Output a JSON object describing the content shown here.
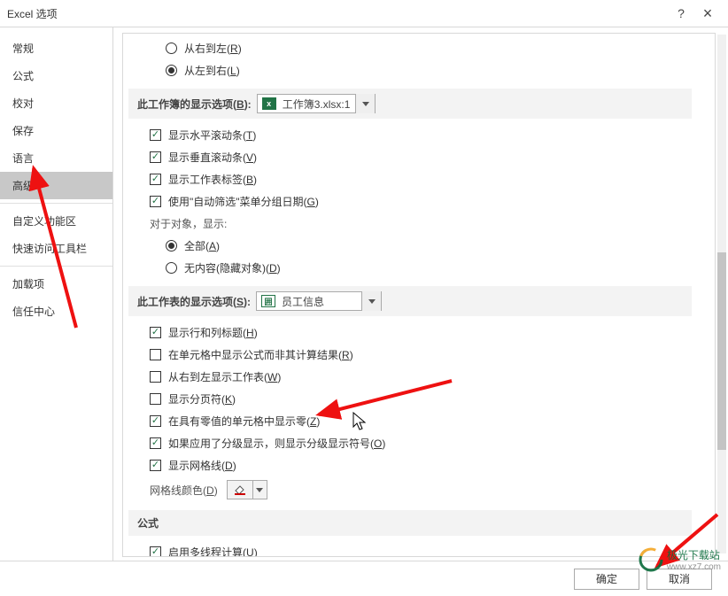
{
  "window": {
    "title": "Excel 选项",
    "help_btn": "?",
    "close_btn": "×"
  },
  "sidebar": {
    "items": [
      {
        "label": "常规"
      },
      {
        "label": "公式"
      },
      {
        "label": "校对"
      },
      {
        "label": "保存"
      },
      {
        "label": "语言"
      },
      {
        "label": "高级",
        "selected": true
      },
      {
        "label": "自定义功能区"
      },
      {
        "label": "快速访问工具栏"
      },
      {
        "label": "加载项"
      },
      {
        "label": "信任中心"
      }
    ]
  },
  "top_radio": {
    "opt1": "从右到左",
    "opt1_key": "R",
    "opt2": "从左到右",
    "opt2_key": "L"
  },
  "section_workbook": {
    "label": "此工作簿的显示选项",
    "key": "B",
    "dropdown": "工作簿3.xlsx:1",
    "items": {
      "horiz_scroll": {
        "label": "显示水平滚动条",
        "key": "T",
        "checked": true
      },
      "vert_scroll": {
        "label": "显示垂直滚动条",
        "key": "V",
        "checked": true
      },
      "sheet_tabs": {
        "label": "显示工作表标签",
        "key": "B",
        "checked": true
      },
      "autofilter": {
        "label": "使用\"自动筛选\"菜单分组日期",
        "key": "G",
        "checked": true
      }
    },
    "objects_label": "对于对象，显示:",
    "obj_all": {
      "label": "全部",
      "key": "A"
    },
    "obj_none": {
      "label": "无内容(隐藏对象)",
      "key": "D"
    }
  },
  "section_worksheet": {
    "label": "此工作表的显示选项",
    "key": "S",
    "dropdown": "员工信息",
    "items": {
      "row_col_headers": {
        "label": "显示行和列标题",
        "key": "H",
        "checked": true
      },
      "show_formulas": {
        "label": "在单元格中显示公式而非其计算结果",
        "key": "R",
        "checked": false
      },
      "rtl_sheet": {
        "label": "从右到左显示工作表",
        "key": "W",
        "checked": false
      },
      "page_breaks": {
        "label": "显示分页符",
        "key": "K",
        "checked": false
      },
      "show_zero": {
        "label": "在具有零值的单元格中显示零",
        "key": "Z",
        "checked": true
      },
      "outline_symbols": {
        "label": "如果应用了分级显示，则显示分级显示符号",
        "key": "O",
        "checked": true
      },
      "gridlines": {
        "label": "显示网格线",
        "key": "D",
        "checked": true
      }
    },
    "gridline_color": {
      "label": "网格线颜色",
      "key": "D"
    }
  },
  "section_formula": {
    "label": "公式",
    "multithread": {
      "label": "启用多线程计算",
      "key": "U",
      "checked": true
    }
  },
  "footer": {
    "ok": "确定",
    "cancel": "取消"
  },
  "watermark": {
    "name": "极光下载站",
    "url": "www.xz7.com"
  }
}
